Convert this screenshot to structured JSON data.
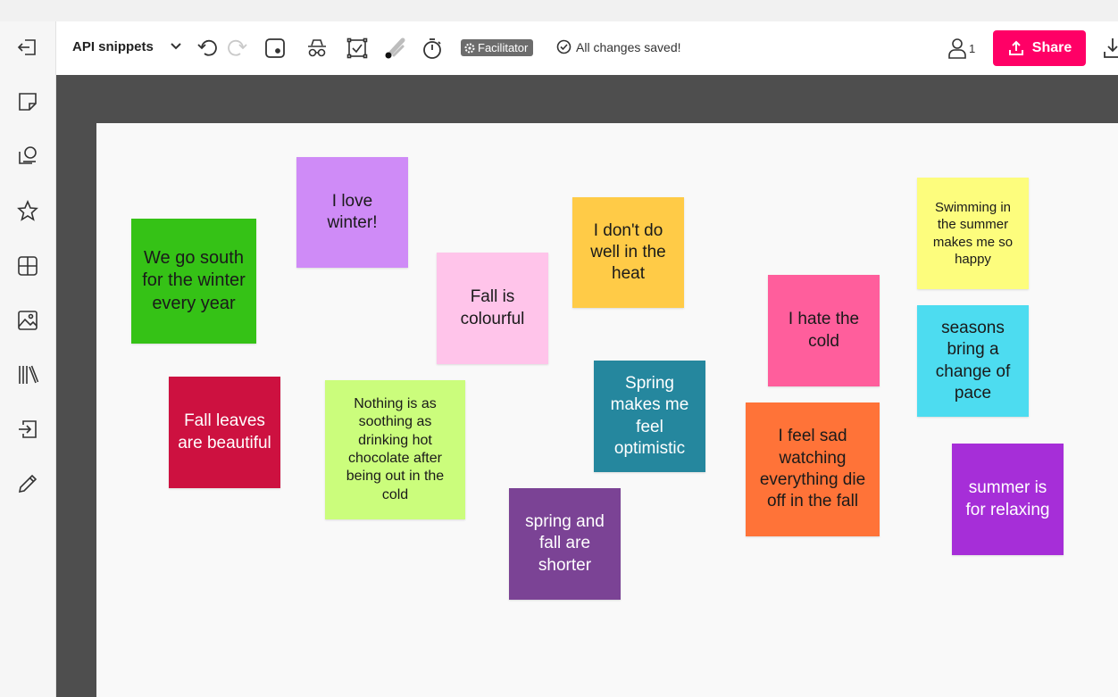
{
  "toolbar": {
    "board_title": "API snippets",
    "facilitator_label": "Facilitator",
    "save_status": "All changes saved!",
    "user_count": "1",
    "share_label": "Share"
  },
  "colors": {
    "brand_pink": "#ff0066",
    "canvas_background": "#4e4e4e",
    "board_background": "#f9f9f9"
  },
  "sidebar": {
    "icons": [
      "exit-icon",
      "sticky-note-icon",
      "shapes-icon",
      "star-icon",
      "grid-icon",
      "image-icon",
      "library-icon",
      "import-icon",
      "pencil-icon"
    ]
  },
  "notes": [
    {
      "text": "We go south for the winter every year",
      "color": "#35c216",
      "text_color": "#1a1a1a"
    },
    {
      "text": "I love winter!",
      "color": "#cf8bf7",
      "text_color": "#1a1a1a"
    },
    {
      "text": "Fall is colourful",
      "color": "#ffc4ea",
      "text_color": "#1a1a1a"
    },
    {
      "text": "I don't do well in the heat",
      "color": "#ffcb47",
      "text_color": "#1a1a1a"
    },
    {
      "text": "Swimming in the summer makes me so happy",
      "color": "#fdfd7d",
      "text_color": "#1a1a1a"
    },
    {
      "text": "I hate the cold",
      "color": "#ff5e9c",
      "text_color": "#1a1a1a"
    },
    {
      "text": "seasons bring a change of pace",
      "color": "#4ddcf0",
      "text_color": "#1a1a1a"
    },
    {
      "text": "Fall leaves are beautiful",
      "color": "#cd1140",
      "text_color": "#ffffff"
    },
    {
      "text": "Nothing is as soothing as drinking hot chocolate after being out in the cold",
      "color": "#cbfd7c",
      "text_color": "#1a1a1a"
    },
    {
      "text": "Spring makes me feel optimistic",
      "color": "#25879e",
      "text_color": "#ffffff"
    },
    {
      "text": "I feel sad watching everything die off in the fall",
      "color": "#ff7338",
      "text_color": "#1a1a1a"
    },
    {
      "text": "summer is for relaxing",
      "color": "#a62ed8",
      "text_color": "#ffffff"
    },
    {
      "text": "spring and fall are shorter",
      "color": "#7b4395",
      "text_color": "#ffffff"
    }
  ]
}
